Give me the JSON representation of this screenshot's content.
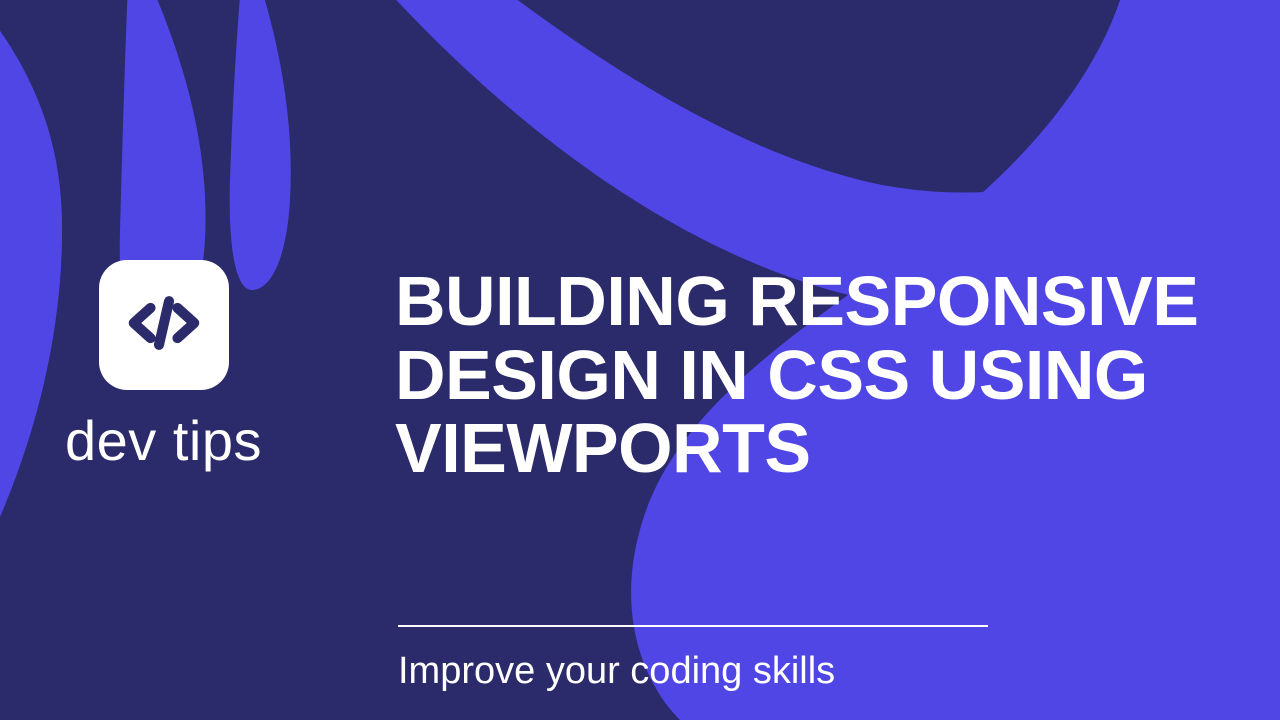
{
  "colors": {
    "background": "#2b2a6a",
    "accent": "#4f46e5",
    "text": "#ffffff"
  },
  "logo": {
    "icon_name": "code-slash-icon",
    "label": "dev tips"
  },
  "headline": "BUILDING RESPONSIVE DESIGN IN CSS USING VIEWPORTS",
  "subheadline": "Improve your coding skills"
}
